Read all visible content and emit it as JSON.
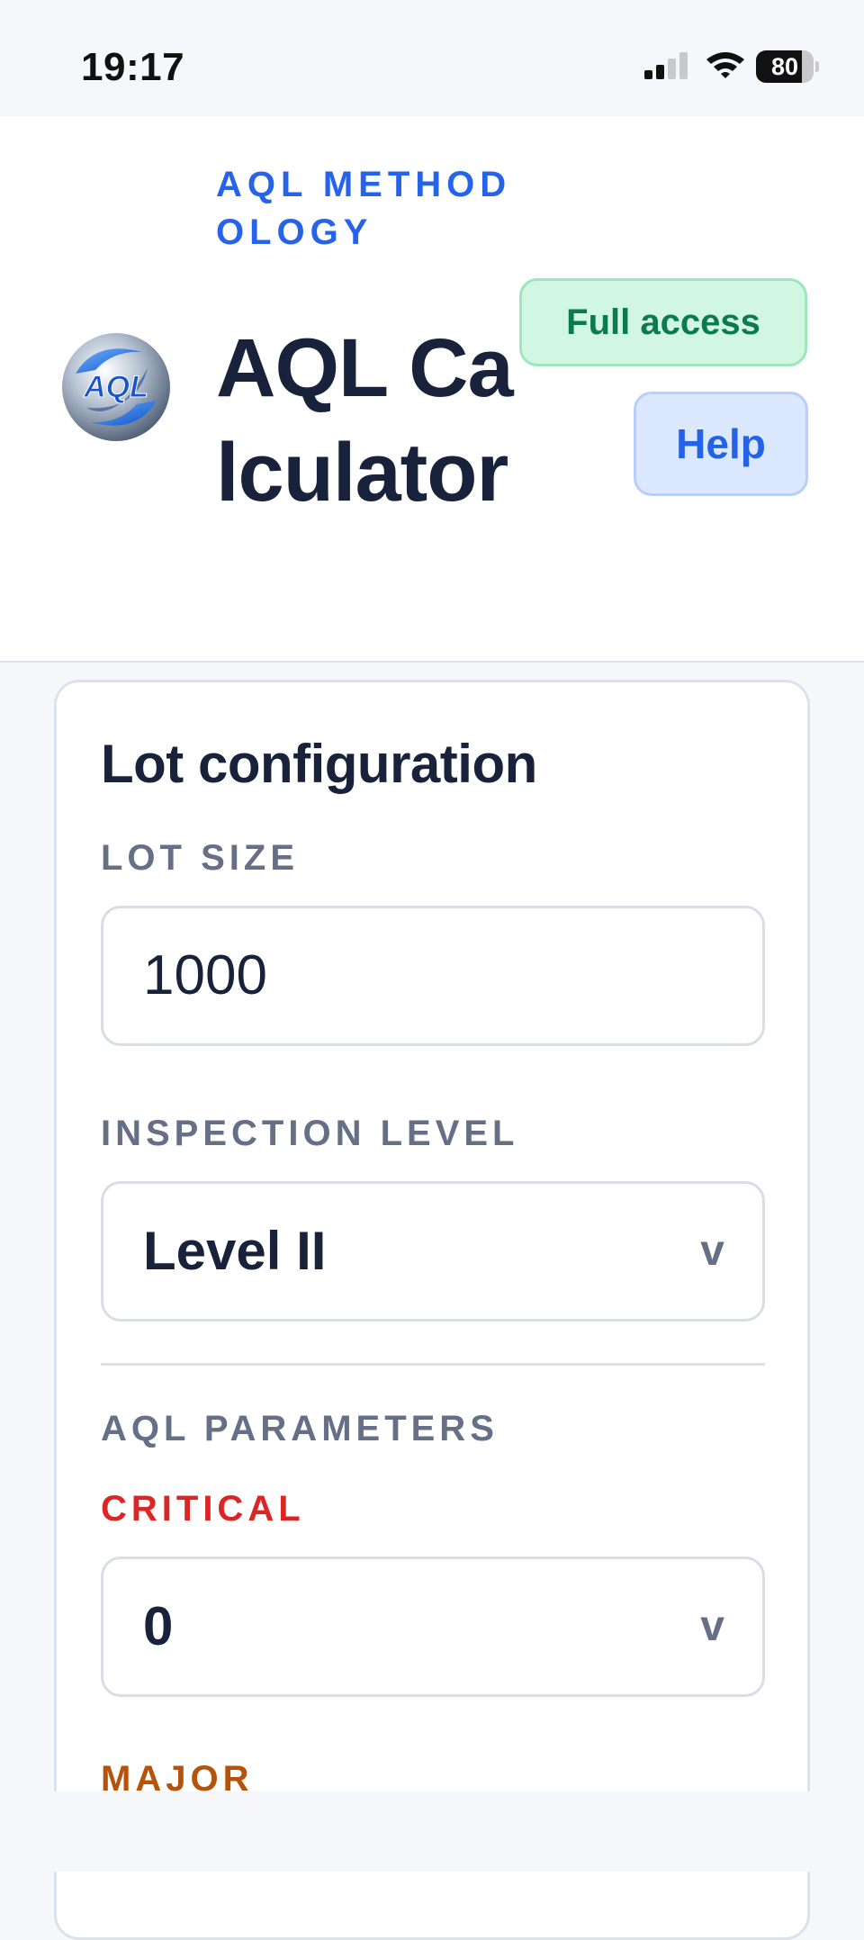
{
  "status_bar": {
    "time": "19:17",
    "battery_level": "80",
    "battery_fraction": 0.8,
    "icons": [
      "cellular-signal-icon",
      "wifi-icon",
      "battery-icon"
    ]
  },
  "header": {
    "eyebrow": "AQL METHODOLOGY",
    "title": "AQL Calculator",
    "logo_text": "AQL",
    "access_badge": "Full access",
    "help_label": "Help"
  },
  "lot_configuration": {
    "title": "Lot configuration",
    "lot_size_label": "LOT SIZE",
    "lot_size_value": "1000",
    "inspection_level_label": "INSPECTION LEVEL",
    "inspection_level_value": "Level II",
    "aql_parameters_label": "AQL PARAMETERS",
    "critical_label": "CRITICAL",
    "critical_value": "0",
    "major_label": "MAJOR",
    "chevron": "v"
  },
  "colors": {
    "accent_blue": "#2563eb",
    "success_green": "#0b7a4d",
    "critical_red": "#dc2626",
    "major_orange": "#b45309",
    "text_dark": "#18223a",
    "label_gray": "#657086"
  }
}
